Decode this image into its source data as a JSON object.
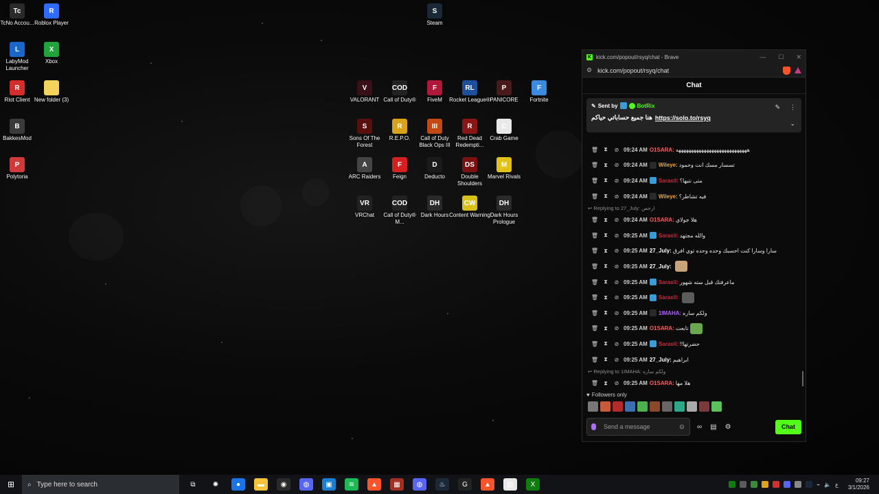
{
  "desktop": {
    "icons": [
      {
        "label": "TcNo Accou...",
        "color": "#2a2a2a",
        "glyph": "Tc"
      },
      {
        "label": "Roblox Player",
        "color": "#2f6bff",
        "glyph": "R"
      },
      {
        "label": "LabyMod Launcher",
        "color": "#1a66c9",
        "glyph": "L"
      },
      {
        "label": "Xbox",
        "color": "#1fa33a",
        "glyph": "X"
      },
      {
        "label": "Riot Client",
        "color": "#d32d2d",
        "glyph": "R"
      },
      {
        "label": "New folder (3)",
        "color": "#f3d35b",
        "glyph": ""
      },
      {
        "label": "BakkesMod",
        "color": "#3a3a3a",
        "glyph": "B"
      },
      {
        "label": "Polytoria",
        "color": "#d03a3a",
        "glyph": "P"
      },
      {
        "label": "Steam",
        "color": "#1b2838",
        "glyph": "S"
      },
      {
        "label": "VALORANT",
        "color": "#3a1016",
        "glyph": "V"
      },
      {
        "label": "Call of Duty®",
        "color": "#222",
        "glyph": "COD"
      },
      {
        "label": "FiveM",
        "color": "#b0183a",
        "glyph": "F"
      },
      {
        "label": "Rocket League®",
        "color": "#1e4f9c",
        "glyph": "RL"
      },
      {
        "label": "PANICORE",
        "color": "#4a1a1a",
        "glyph": "P"
      },
      {
        "label": "Fortnite",
        "color": "#3b8be0",
        "glyph": "F"
      },
      {
        "label": "Sons Of The Forest",
        "color": "#5a0f0f",
        "glyph": "S"
      },
      {
        "label": "R.E.P.O.",
        "color": "#d9a21b",
        "glyph": "R"
      },
      {
        "label": "Call of Duty Black Ops III",
        "color": "#c24a12",
        "glyph": "III"
      },
      {
        "label": "Red Dead Redempti...",
        "color": "#8a1515",
        "glyph": "R"
      },
      {
        "label": "Crab Game",
        "color": "#e8e8e8",
        "glyph": "C"
      },
      {
        "label": "ARC Raiders",
        "color": "#444",
        "glyph": "A"
      },
      {
        "label": "Feign",
        "color": "#d42020",
        "glyph": "F"
      },
      {
        "label": "Deducto",
        "color": "#1a1a1a",
        "glyph": "D"
      },
      {
        "label": "Double Shoulders",
        "color": "#7a1010",
        "glyph": "DS"
      },
      {
        "label": "Marvel Rivals",
        "color": "#e2c21a",
        "glyph": "M"
      },
      {
        "label": "VRChat",
        "color": "#222",
        "glyph": "VR"
      },
      {
        "label": "Call of Duty® M...",
        "color": "#222",
        "glyph": "COD"
      },
      {
        "label": "Dark Hours",
        "color": "#2a2a2a",
        "glyph": "DH"
      },
      {
        "label": "Content Warning",
        "color": "#d8c21a",
        "glyph": "CW"
      },
      {
        "label": "Dark Hours Prologue",
        "color": "#2a2a2a",
        "glyph": "DH"
      }
    ]
  },
  "browser": {
    "title": "kick.com/popout/rsyq/chat - Brave",
    "url": "kick.com/popout/rsyq/chat",
    "chat_header": "Chat",
    "pinned": {
      "sent_by": "Sent by",
      "author": "BotRix",
      "text": "هنا جميع حساباتي حياكم",
      "link": "https://solo.to/rsyq"
    },
    "messages": [
      {
        "type": "msg",
        "time": "09:24 AM",
        "user": "O1SARA:",
        "color": "#ff5e5e",
        "badge": "",
        "text": "ههههههههههههههههههههههههههههه",
        "emote": ""
      },
      {
        "type": "msg",
        "time": "09:24 AM",
        "user": "Wileye:",
        "color": "#f0a63a",
        "badge": "#2a2a2a",
        "text": "تسسار مسك انت وحمود",
        "emote": ""
      },
      {
        "type": "msg",
        "time": "09:24 AM",
        "user": "Saraxil:",
        "color": "#e0213c",
        "badge": "#3b9bd6",
        "text": "متى نتيها؟",
        "emote": ""
      },
      {
        "type": "msg",
        "time": "09:24 AM",
        "user": "Wileye:",
        "color": "#f0a63a",
        "badge": "#2a2a2a",
        "text": "فيه تشاطر؟",
        "emote": ""
      },
      {
        "type": "reply",
        "text": "Replying to 27_July: ارخص"
      },
      {
        "type": "msg",
        "time": "09:24 AM",
        "user": "O1SARA:",
        "color": "#ff5e5e",
        "badge": "",
        "text": "هلا جولاي",
        "emote": ""
      },
      {
        "type": "msg",
        "time": "09:25 AM",
        "user": "Saraxil:",
        "color": "#e0213c",
        "badge": "#3b9bd6",
        "text": "والله مجتهد",
        "emote": ""
      },
      {
        "type": "msg",
        "time": "09:25 AM",
        "user": "27_July:",
        "color": "#ffffff",
        "badge": "",
        "text": "سارا وسارا كنت احسبك وحده وحده توي افرق",
        "emote": ""
      },
      {
        "type": "msg",
        "time": "09:25 AM",
        "user": "27_July:",
        "color": "#ffffff",
        "badge": "",
        "text": "",
        "emote": "#caa27a"
      },
      {
        "type": "msg",
        "time": "09:25 AM",
        "user": "Saraxil:",
        "color": "#e0213c",
        "badge": "#3b9bd6",
        "text": "ماعرفتك قبل سته شهور",
        "emote": ""
      },
      {
        "type": "msg",
        "time": "09:25 AM",
        "user": "Saraxil:",
        "color": "#e0213c",
        "badge": "#3b9bd6",
        "text": "",
        "emote": "#5c5c5c"
      },
      {
        "type": "msg",
        "time": "09:25 AM",
        "user": "1IMAHA:",
        "color": "#b060ff",
        "badge": "#2a2a2a",
        "text": "ولكم ساره",
        "emote": ""
      },
      {
        "type": "msg",
        "time": "09:25 AM",
        "user": "O1SARA:",
        "color": "#ff5e5e",
        "badge": "",
        "text": "تابعت",
        "emote": "#6aa84f"
      },
      {
        "type": "msg",
        "time": "09:25 AM",
        "user": "Saraxil:",
        "color": "#e0213c",
        "badge": "#3b9bd6",
        "text": "حضرتها!!",
        "emote": ""
      },
      {
        "type": "msg",
        "time": "09:25 AM",
        "user": "27_July:",
        "color": "#ffffff",
        "badge": "",
        "text": "ابراهيم",
        "emote": ""
      },
      {
        "type": "reply",
        "text": "Replying to 1IMAHA: ولكم ساره"
      },
      {
        "type": "msg",
        "time": "09:25 AM",
        "user": "O1SARA:",
        "color": "#ff5e5e",
        "badge": "",
        "text": "هلا مها",
        "emote": ""
      }
    ],
    "followers_only": "Followers only",
    "emote_colors": [
      "#777",
      "#c85a3a",
      "#b32b2b",
      "#3a6fb0",
      "#4caf50",
      "#8a4a2a",
      "#666",
      "#2fa88a",
      "#aaa",
      "#7a3a3a",
      "#5bc25b"
    ],
    "input_placeholder": "Send a message",
    "send_label": "Chat"
  },
  "taskbar": {
    "search_placeholder": "Type here to search",
    "apps": [
      {
        "name": "task-view",
        "color": "transparent",
        "glyph": "⧉"
      },
      {
        "name": "steelseries",
        "color": "transparent",
        "glyph": "✺"
      },
      {
        "name": "chrome",
        "color": "#1a73e8",
        "glyph": "●"
      },
      {
        "name": "file-explorer",
        "color": "#f3c33a",
        "glyph": "▬"
      },
      {
        "name": "app-red",
        "color": "#2a2a2a",
        "glyph": "◉"
      },
      {
        "name": "discord-ptb",
        "color": "#5865f2",
        "glyph": "◍"
      },
      {
        "name": "store",
        "color": "#1a7fd1",
        "glyph": "▣"
      },
      {
        "name": "spotify",
        "color": "#1db954",
        "glyph": "≋"
      },
      {
        "name": "brave",
        "color": "#fb542b",
        "glyph": "▲"
      },
      {
        "name": "game",
        "color": "#a03020",
        "glyph": "▦"
      },
      {
        "name": "discord",
        "color": "#5865f2",
        "glyph": "◍"
      },
      {
        "name": "steam",
        "color": "#1b2838",
        "glyph": "♨"
      },
      {
        "name": "g-hub",
        "color": "#222",
        "glyph": "G"
      },
      {
        "name": "brave-active",
        "color": "#fb542b",
        "glyph": "▲"
      },
      {
        "name": "calendar",
        "color": "#e8e8e8",
        "glyph": "▥"
      },
      {
        "name": "xbox",
        "color": "#107c10",
        "glyph": "X"
      }
    ],
    "time": "09:27",
    "date": "3/1/2026",
    "lang": "ع"
  }
}
